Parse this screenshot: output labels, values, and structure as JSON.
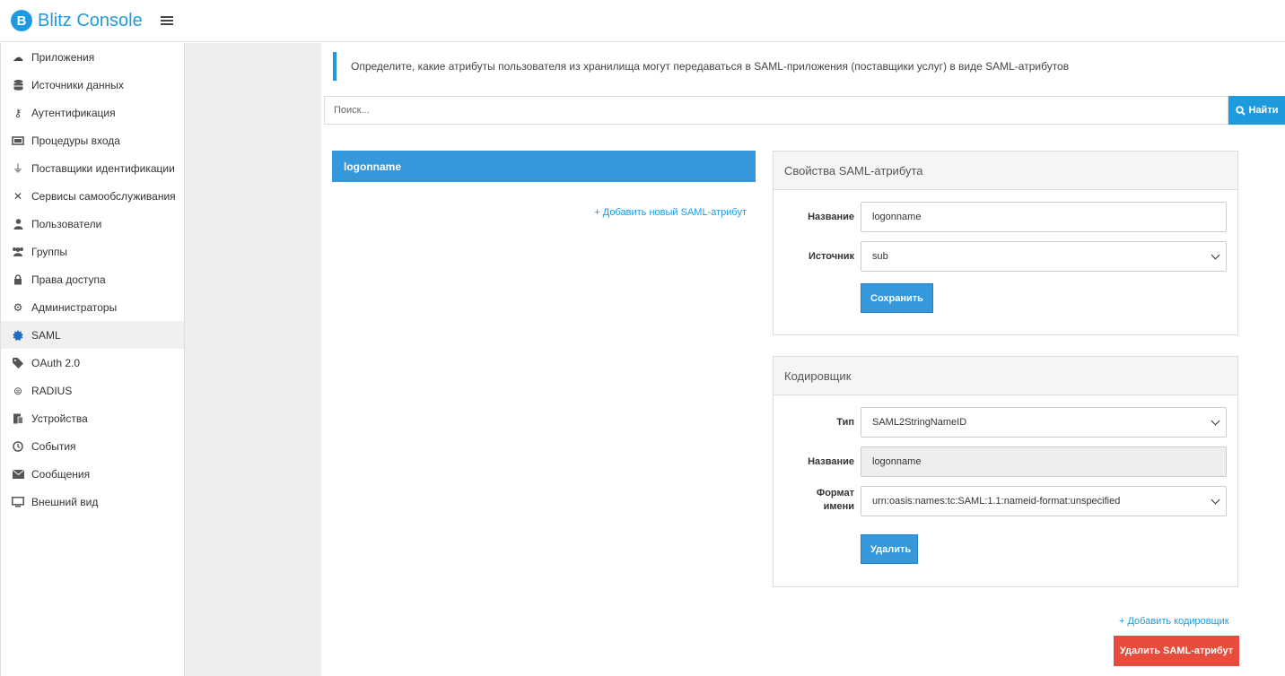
{
  "app": {
    "logo_letter": "B",
    "title": "Blitz Console"
  },
  "sidebar": {
    "items": [
      {
        "label": "Приложения",
        "icon": "cloud-icon"
      },
      {
        "label": "Источники данных",
        "icon": "database-icon"
      },
      {
        "label": "Аутентификация",
        "icon": "key-icon"
      },
      {
        "label": "Процедуры входа",
        "icon": "login-procedure-icon"
      },
      {
        "label": "Поставщики идентификации",
        "icon": "plug-icon"
      },
      {
        "label": "Сервисы самообслуживания",
        "icon": "tools-icon"
      },
      {
        "label": "Пользователи",
        "icon": "user-icon"
      },
      {
        "label": "Группы",
        "icon": "users-icon"
      },
      {
        "label": "Права доступа",
        "icon": "lock-icon"
      },
      {
        "label": "Администраторы",
        "icon": "gears-icon"
      },
      {
        "label": "SAML",
        "icon": "certificate-icon"
      },
      {
        "label": "OAuth 2.0",
        "icon": "tag-icon"
      },
      {
        "label": "RADIUS",
        "icon": "radius-icon"
      },
      {
        "label": "Устройства",
        "icon": "devices-icon"
      },
      {
        "label": "События",
        "icon": "clock-icon"
      },
      {
        "label": "Сообщения",
        "icon": "envelope-icon"
      },
      {
        "label": "Внешний вид",
        "icon": "monitor-icon"
      }
    ],
    "active_index": 10
  },
  "main": {
    "callout": "Определите, какие атрибуты пользователя из хранилища могут передаваться в SAML-приложения (поставщики услуг) в виде SAML-атрибутов",
    "search": {
      "placeholder": "Поиск...",
      "button": "Найти"
    },
    "attributes": [
      "logonname"
    ],
    "add_attribute": "+ Добавить новый SAML-атрибут",
    "properties": {
      "heading": "Свойства SAML-атрибута",
      "name_label": "Название",
      "name_value": "logonname",
      "source_label": "Источник",
      "source_value": "sub",
      "save_button": "Сохранить"
    },
    "encoder": {
      "heading": "Кодировщик",
      "type_label": "Тип",
      "type_value": "SAML2StringNameID",
      "name_label": "Название",
      "name_value": "logonname",
      "format_label_line1": "Формат",
      "format_label_line2": "имени",
      "format_value": "urn:oasis:names:tc:SAML:1.1:nameid-format:unspecified",
      "delete_button": "Удалить"
    },
    "add_encoder": "+ Добавить кодировщик",
    "delete_attribute_button": "Удалить SAML-атрибут"
  }
}
